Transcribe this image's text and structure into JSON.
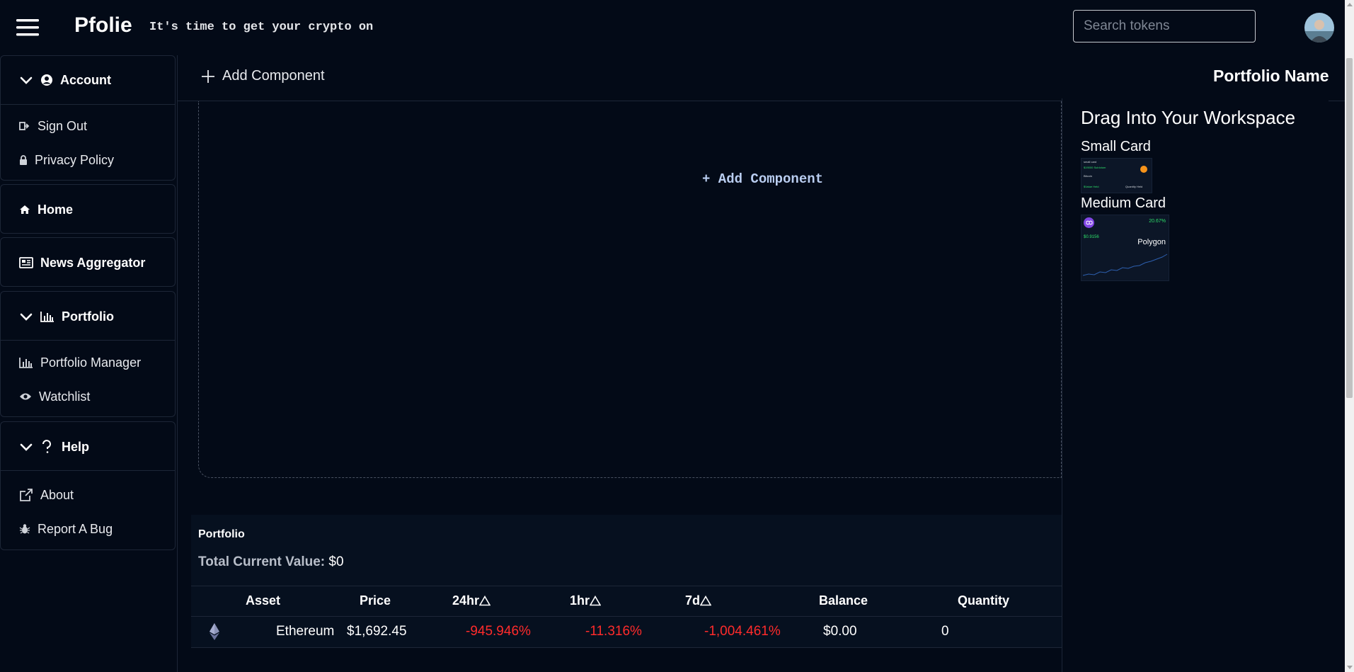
{
  "app": {
    "brand": "Pfolie",
    "tagline": "It's time to get your crypto on",
    "search_placeholder": "Search tokens"
  },
  "sidebar": {
    "account": {
      "label": "Account",
      "items": [
        "Sign Out",
        "Privacy Policy"
      ]
    },
    "home": "Home",
    "news": "News Aggregator",
    "portfolio": {
      "label": "Portfolio",
      "items": [
        "Portfolio Manager",
        "Watchlist"
      ]
    },
    "help": {
      "label": "Help",
      "items": [
        "About",
        "Report A Bug"
      ]
    }
  },
  "main": {
    "add_component": "Add Component",
    "portfolio_name": "Portfolio Name",
    "workspace_add": "+ Add Component"
  },
  "right_panel": {
    "title": "Drag Into Your Workspace",
    "small_card": {
      "label": "Small Card",
      "preview": {
        "t1": "small card",
        "t2": "$19000 SubIctum",
        "t3": "Bitcoin",
        "t4": "$Value Held",
        "t5": "Quantity Held"
      }
    },
    "medium_card": {
      "label": "Medium Card",
      "preview": {
        "change": "20.67%",
        "price": "$0.9156",
        "name": "Polygon"
      }
    }
  },
  "portfolio_table": {
    "title": "Portfolio",
    "total_label": "Total Current Value:",
    "total_value": "$0",
    "columns": [
      "Asset",
      "Price",
      "24hr",
      "1hr",
      "7d",
      "Balance",
      "Quantity"
    ],
    "rows": [
      {
        "asset": "Ethereum",
        "price": "$1,692.45",
        "h24": "-945.946%",
        "h1": "-11.316%",
        "d7": "-1,004.461%",
        "balance": "$0.00",
        "quantity": "0"
      }
    ]
  },
  "colors": {
    "background": "#030a17",
    "negative": "#ff2b2b",
    "accent_green": "#2ee06a",
    "link_blue": "#b9cdf0"
  },
  "icons": [
    "hamburger-icon",
    "chevron-down-icon",
    "user-circle-icon",
    "sign-out-icon",
    "lock-icon",
    "home-icon",
    "newspaper-icon",
    "bar-chart-icon",
    "eye-icon",
    "question-icon",
    "external-link-icon",
    "bug-icon",
    "plus-icon",
    "triangle-icon",
    "ethereum-icon"
  ]
}
